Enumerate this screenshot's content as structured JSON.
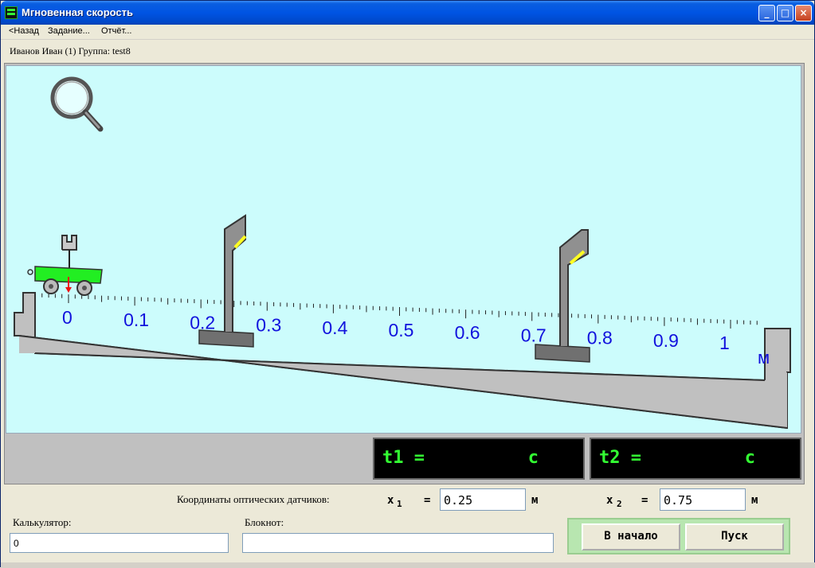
{
  "window": {
    "title": "Мгновенная скорость"
  },
  "menu": {
    "back": "<Назад",
    "task": "Задание...",
    "report": "Отчёт..."
  },
  "user": {
    "line": "Иванов Иван (1)  Группа: test8"
  },
  "ruler": {
    "labels": [
      "0",
      "0.1",
      "0.2",
      "0.3",
      "0.4",
      "0.5",
      "0.6",
      "0.7",
      "0.8",
      "0.9",
      "1"
    ],
    "unit": "м"
  },
  "timers": {
    "t1_label": "t1 =",
    "t1_unit": "c",
    "t2_label": "t2 =",
    "t2_unit": "c"
  },
  "sensors": {
    "caption": "Координаты оптических датчиков:",
    "x1_label": "x",
    "x1_sub": "1",
    "x1_eq": "=",
    "x1_value": "0.25",
    "x1_unit": "м",
    "x2_label": "x",
    "x2_sub": "2",
    "x2_eq": "=",
    "x2_value": "0.75",
    "x2_unit": "м"
  },
  "calculator": {
    "label": "Калькулятор:",
    "value": "0"
  },
  "notepad": {
    "label": "Блокнот:",
    "value": ""
  },
  "buttons": {
    "reset": "В начало",
    "start": "Пуск"
  },
  "colors": {
    "stage_bg": "#ccfcfc",
    "lcd_text": "#33ff33",
    "cart": "#22ee22",
    "ruler": "#c0c0c0",
    "ruler_labels": "#1111dd"
  }
}
